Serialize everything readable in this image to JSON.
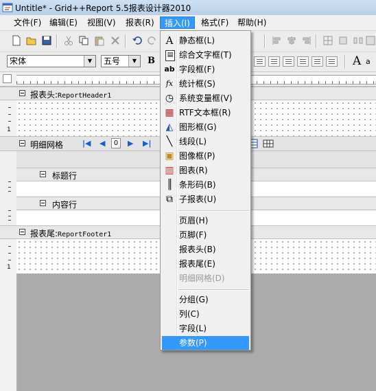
{
  "window": {
    "title": "Untitle* - Grid++Report 5.5报表设计器2010"
  },
  "menubar": [
    {
      "label": "文件(F)"
    },
    {
      "label": "编辑(E)"
    },
    {
      "label": "视图(V)"
    },
    {
      "label": "报表(R)"
    },
    {
      "label": "插入(I)"
    },
    {
      "label": "格式(F)"
    },
    {
      "label": "帮助(H)"
    }
  ],
  "toolbar2": {
    "font": "宋体",
    "size": "五号",
    "bold": "B"
  },
  "bands": {
    "report_header": {
      "label": "报表头:",
      "name": "ReportHeader1"
    },
    "detail_grid": {
      "label": "明细网格",
      "page": "0"
    },
    "title_row": {
      "label": "标题行"
    },
    "content_row": {
      "label": "内容行"
    },
    "report_footer": {
      "label": "报表尾:",
      "name": "ReportFooter1"
    }
  },
  "vruler_num": "1",
  "insert_menu": {
    "items": [
      {
        "label": "静态框(L)",
        "icon": "A"
      },
      {
        "label": "综合文字框(T)",
        "icon": "▤"
      },
      {
        "label": "字段框(F)",
        "icon": "ab"
      },
      {
        "label": "统计框(S)",
        "icon": "fx"
      },
      {
        "label": "系统变量框(V)",
        "icon": "◷"
      },
      {
        "label": "RTF文本框(R)",
        "icon": "▦"
      },
      {
        "label": "图形框(G)",
        "icon": "◭"
      },
      {
        "label": "线段(L)",
        "icon": "╲"
      },
      {
        "label": "图像框(P)",
        "icon": "▣"
      },
      {
        "label": "图表(R)",
        "icon": "▥"
      },
      {
        "label": "条形码(B)",
        "icon": "║"
      },
      {
        "label": "子报表(U)",
        "icon": "⧉"
      }
    ],
    "group2": [
      {
        "label": "页眉(H)"
      },
      {
        "label": "页脚(F)"
      },
      {
        "label": "报表头(B)"
      },
      {
        "label": "报表尾(E)"
      },
      {
        "label": "明细网格(D)",
        "disabled": true
      }
    ],
    "group3": [
      {
        "label": "分组(G)"
      },
      {
        "label": "列(C)"
      },
      {
        "label": "字段(L)"
      },
      {
        "label": "参数(P)",
        "highlighted": true
      }
    ]
  },
  "colors": {
    "highlight": "#3399ff",
    "menu_bg": "#f0f0f0"
  }
}
